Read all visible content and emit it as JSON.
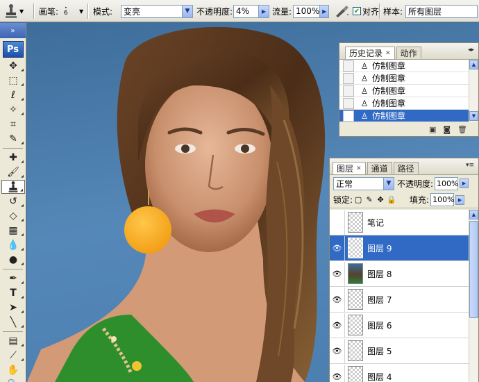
{
  "options_bar": {
    "tool_icon": "clone-stamp-icon",
    "brush_label": "画笔:",
    "brush_size": "6",
    "mode_label": "模式:",
    "mode_value": "变亮",
    "opacity_label": "不透明度:",
    "opacity_value": "4%",
    "flow_label": "流量:",
    "flow_value": "100%",
    "airbrush_icon": "airbrush-icon",
    "aligned_label": "对齐",
    "aligned_checked": true,
    "sample_label": "样本:",
    "sample_value": "所有图层"
  },
  "toolbox": {
    "logo": "Ps",
    "tools": [
      "move-tool",
      "marquee-tool",
      "lasso-tool",
      "magic-wand-tool",
      "crop-tool",
      "slice-tool",
      "healing-brush-tool",
      "brush-tool",
      "clone-stamp-tool",
      "history-brush-tool",
      "eraser-tool",
      "gradient-tool",
      "blur-tool",
      "dodge-tool",
      "pen-tool",
      "type-tool",
      "path-selection-tool",
      "line-tool",
      "notes-tool",
      "eyedropper-tool",
      "hand-tool",
      "zoom-tool"
    ],
    "active_tool": "clone-stamp-tool"
  },
  "history_panel": {
    "tabs": [
      {
        "label": "历史记录",
        "selected": true,
        "closable": true
      },
      {
        "label": "动作",
        "selected": false,
        "closable": false
      }
    ],
    "items": [
      {
        "label": "仿制图章",
        "selected": false
      },
      {
        "label": "仿制图章",
        "selected": false
      },
      {
        "label": "仿制图章",
        "selected": false
      },
      {
        "label": "仿制图章",
        "selected": false
      },
      {
        "label": "仿制图章",
        "selected": true
      }
    ]
  },
  "layers_panel": {
    "tabs": [
      {
        "label": "图层",
        "selected": true,
        "closable": true
      },
      {
        "label": "通道",
        "selected": false,
        "closable": false
      },
      {
        "label": "路径",
        "selected": false,
        "closable": false
      }
    ],
    "blend_mode": "正常",
    "opacity_label": "不透明度:",
    "opacity_value": "100%",
    "lock_label": "锁定:",
    "fill_label": "填充:",
    "fill_value": "100%",
    "layers": [
      {
        "name": "笔记",
        "visible": false,
        "selected": false,
        "thumb": "transparent"
      },
      {
        "name": "图层 9",
        "visible": true,
        "selected": true,
        "thumb": "transparent"
      },
      {
        "name": "图层 8",
        "visible": true,
        "selected": false,
        "thumb": "photo"
      },
      {
        "name": "图层 7",
        "visible": true,
        "selected": false,
        "thumb": "transparent"
      },
      {
        "name": "图层 6",
        "visible": true,
        "selected": false,
        "thumb": "transparent"
      },
      {
        "name": "图层 5",
        "visible": true,
        "selected": false,
        "thumb": "transparent"
      },
      {
        "name": "图层 4",
        "visible": true,
        "selected": false,
        "thumb": "transparent"
      }
    ]
  },
  "colors": {
    "selection": "#316ac5",
    "panel_bg": "#ece9d8",
    "backdrop_blue": "#4a7eaf"
  }
}
